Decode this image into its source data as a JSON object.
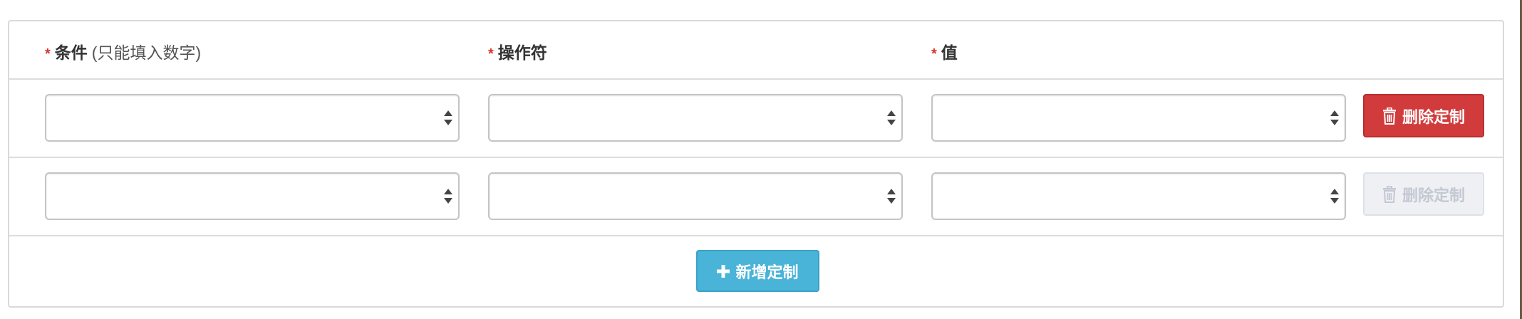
{
  "header": {
    "required_mark": "*",
    "col1_label": "条件",
    "col1_hint": "(只能填入数字)",
    "col2_label": "操作符",
    "col3_label": "值"
  },
  "rows": [
    {
      "condition": "",
      "operator": "",
      "value": "",
      "delete_label": "删除定制",
      "delete_enabled": true
    },
    {
      "condition": "",
      "operator": "",
      "value": "",
      "delete_label": "删除定制",
      "delete_enabled": false
    }
  ],
  "footer": {
    "add_label": "新增定制"
  },
  "icons": {
    "delete": "trash-icon",
    "add": "plus-icon"
  },
  "colors": {
    "required": "#d9312c",
    "danger": "#d13b3b",
    "info": "#4ab3d8",
    "disabled": "#eef0f4"
  }
}
